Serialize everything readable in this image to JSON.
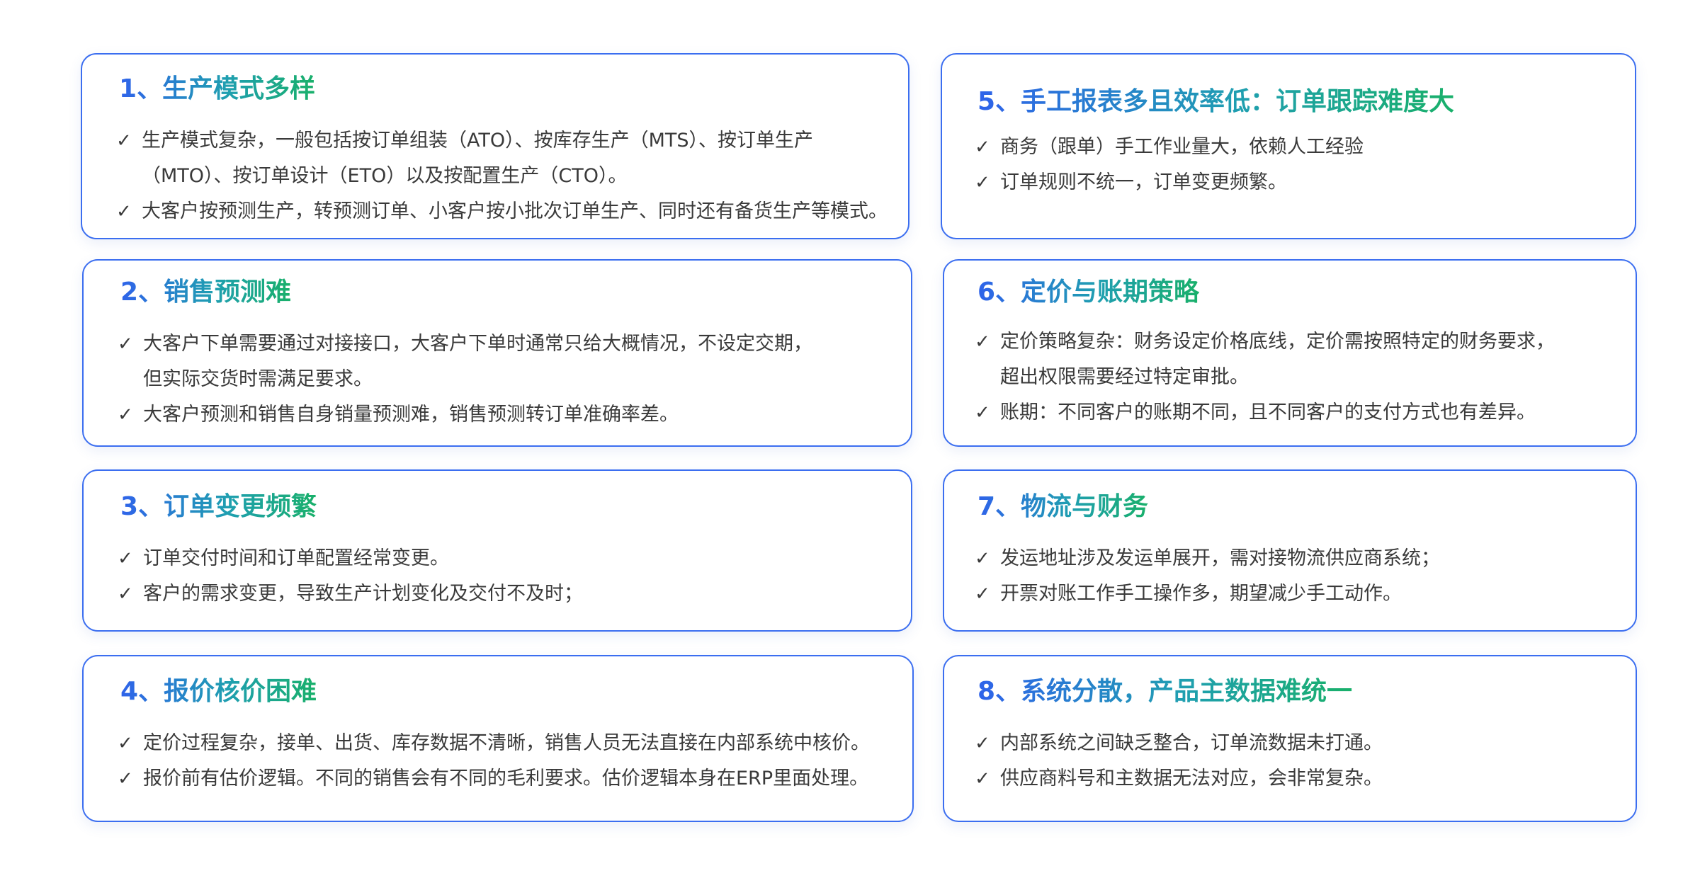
{
  "cards": [
    {
      "title": "1、生产模式多样",
      "items": [
        [
          "生产模式复杂，一般包括按订单组装（ATO）、按库存生产（MTS）、按订单生产",
          "（MTO）、按订单设计（ETO）以及按配置生产（CTO）。"
        ],
        [
          "大客户按预测生产，转预测订单、小客户按小批次订单生产、同时还有备货生产等模式。"
        ]
      ]
    },
    {
      "title": "2、销售预测难",
      "items": [
        [
          "大客户下单需要通过对接接口，大客户下单时通常只给大概情况，不设定交期，",
          "但实际交货时需满足要求。"
        ],
        [
          " 大客户预测和销售自身销量预测难，销售预测转订单准确率差。"
        ]
      ]
    },
    {
      "title": "3、订单变更频繁",
      "items": [
        [
          "订单交付时间和订单配置经常变更。"
        ],
        [
          "客户的需求变更，导致生产计划变化及交付不及时；"
        ]
      ]
    },
    {
      "title": "4、报价核价困难",
      "items": [
        [
          "定价过程复杂，接单、出货、库存数据不清晰，销售人员无法直接在内部系统中核价。"
        ],
        [
          "报价前有估价逻辑。不同的销售会有不同的毛利要求。估价逻辑本身在ERP里面处理。"
        ]
      ]
    },
    {
      "title": "5、手工报表多且效率低：订单跟踪难度大",
      "items": [
        [
          "商务（跟单）手工作业量大，依赖人工经验"
        ],
        [
          "订单规则不统一，订单变更频繁。"
        ]
      ]
    },
    {
      "title": "6、定价与账期策略",
      "items": [
        [
          "定价策略复杂：财务设定价格底线，定价需按照特定的财务要求，",
          "超出权限需要经过特定审批。"
        ],
        [
          "账期：不同客户的账期不同，且不同客户的支付方式也有差异。"
        ]
      ]
    },
    {
      "title": "7、物流与财务",
      "items": [
        [
          "发运地址涉及发运单展开，需对接物流供应商系统；"
        ],
        [
          "开票对账工作手工操作多，期望减少手工动作。"
        ]
      ]
    },
    {
      "title": "8、系统分散，产品主数据难统一",
      "items": [
        [
          "内部系统之间缺乏整合，订单流数据未打通。"
        ],
        [
          "供应商料号和主数据无法对应，会非常复杂。"
        ]
      ]
    }
  ],
  "check_mark": "✓"
}
